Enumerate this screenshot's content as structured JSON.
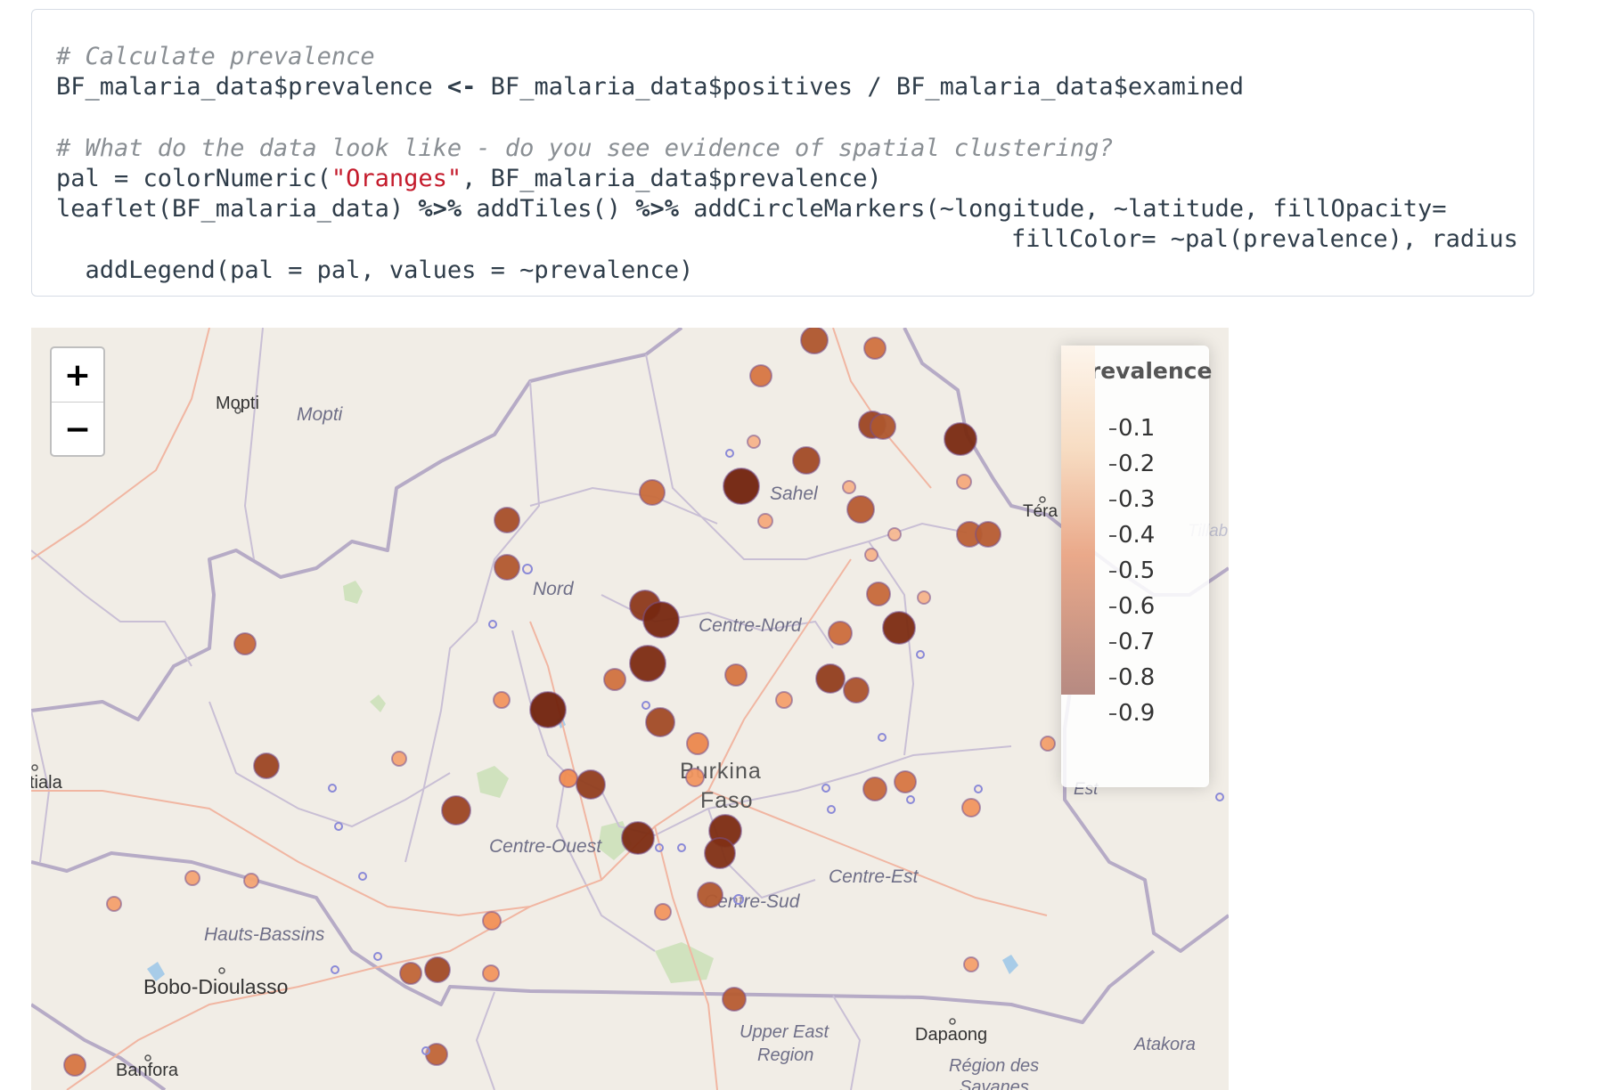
{
  "code": {
    "comment1": "# Calculate prevalence",
    "line2_a": "BF_malaria_data$prevalence ",
    "line2_op": "<-",
    "line2_b": " BF_malaria_data$positives / BF_malaria_data$examined",
    "comment2": "# What do the data look like - do you see evidence of spatial clustering?",
    "line4_a": "pal = colorNumeric(",
    "line4_str": "\"Oranges\"",
    "line4_b": ", BF_malaria_data$prevalence)",
    "line5_a": "leaflet(BF_malaria_data) ",
    "line5_op1": "%>%",
    "line5_b": " addTiles() ",
    "line5_op2": "%>%",
    "line5_c": " addCircleMarkers(~longitude, ~latitude, fillOpacity=",
    "line6": "fillColor= ~pal(prevalence), radius",
    "line7": "  addLegend(pal = pal, values = ~prevalence)"
  },
  "map": {
    "zoom_in_label": "+",
    "zoom_out_label": "−",
    "labels": {
      "mopti_city": "Mopti",
      "mopti_region": "Mopti",
      "sahel": "Sahel",
      "tera": "Téra",
      "tillaberi": "Tillab",
      "nord": "Nord",
      "centre_nord": "Centre-Nord",
      "burkina": "Burkina",
      "faso": "Faso",
      "est": "Est",
      "centre_ouest": "Centre-Ouest",
      "centre_est": "Centre-Est",
      "centre_sud": "Centre-Sud",
      "hauts_bassins": "Hauts-Bassins",
      "bobo": "Bobo-Dioulasso",
      "upper_east_1": "Upper East",
      "upper_east_2": "Region",
      "dapaong": "Dapaong",
      "atakora": "Atakora",
      "region_des": "Région des",
      "savanes": "Savanes",
      "banfora": "Banfora",
      "tiala": "tiala"
    },
    "legend": {
      "title": "prevalence",
      "ticks": [
        "0.1",
        "0.2",
        "0.3",
        "0.4",
        "0.5",
        "0.6",
        "0.7",
        "0.8",
        "0.9"
      ]
    },
    "colors": {
      "light": "#fef0e3",
      "mid": "#f0a060",
      "dark": "#6b1f0a",
      "marker_stroke": "#8a8ad8"
    }
  }
}
